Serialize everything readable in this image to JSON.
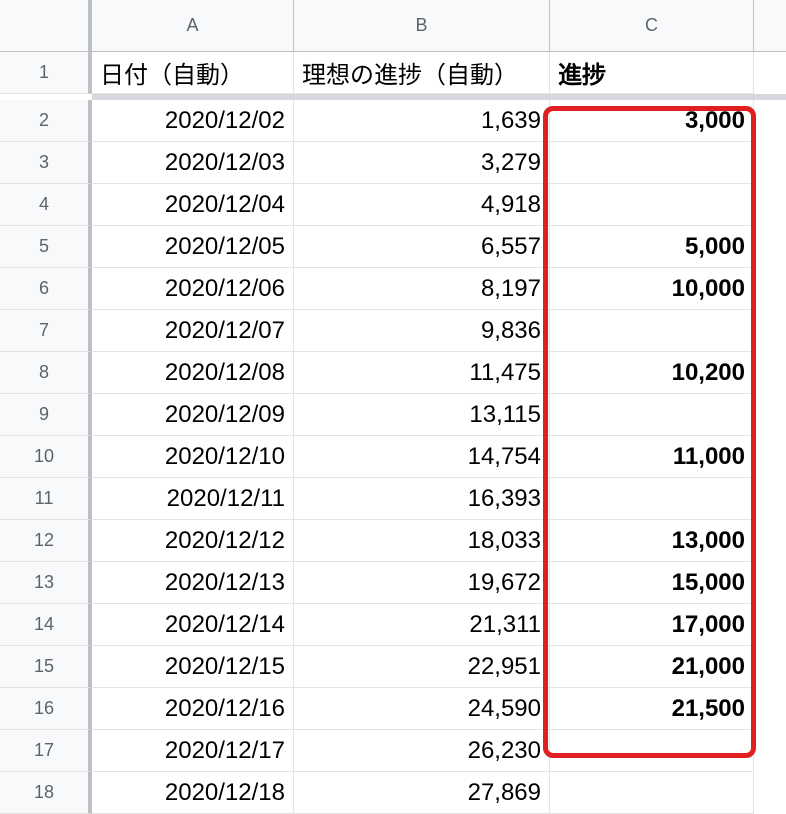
{
  "columns": [
    "A",
    "B",
    "C"
  ],
  "header_row": {
    "num": "1",
    "a": "日付（自動）",
    "b": "理想の進捗（自動）",
    "c": "進捗"
  },
  "rows": [
    {
      "num": "2",
      "date": "2020/12/02",
      "ideal": "1,639",
      "progress": "3,000"
    },
    {
      "num": "3",
      "date": "2020/12/03",
      "ideal": "3,279",
      "progress": ""
    },
    {
      "num": "4",
      "date": "2020/12/04",
      "ideal": "4,918",
      "progress": ""
    },
    {
      "num": "5",
      "date": "2020/12/05",
      "ideal": "6,557",
      "progress": "5,000"
    },
    {
      "num": "6",
      "date": "2020/12/06",
      "ideal": "8,197",
      "progress": "10,000"
    },
    {
      "num": "7",
      "date": "2020/12/07",
      "ideal": "9,836",
      "progress": ""
    },
    {
      "num": "8",
      "date": "2020/12/08",
      "ideal": "11,475",
      "progress": "10,200"
    },
    {
      "num": "9",
      "date": "2020/12/09",
      "ideal": "13,115",
      "progress": ""
    },
    {
      "num": "10",
      "date": "2020/12/10",
      "ideal": "14,754",
      "progress": "11,000"
    },
    {
      "num": "11",
      "date": "2020/12/11",
      "ideal": "16,393",
      "progress": ""
    },
    {
      "num": "12",
      "date": "2020/12/12",
      "ideal": "18,033",
      "progress": "13,000"
    },
    {
      "num": "13",
      "date": "2020/12/13",
      "ideal": "19,672",
      "progress": "15,000"
    },
    {
      "num": "14",
      "date": "2020/12/14",
      "ideal": "21,311",
      "progress": "17,000"
    },
    {
      "num": "15",
      "date": "2020/12/15",
      "ideal": "22,951",
      "progress": "21,000"
    },
    {
      "num": "16",
      "date": "2020/12/16",
      "ideal": "24,590",
      "progress": "21,500"
    },
    {
      "num": "17",
      "date": "2020/12/17",
      "ideal": "26,230",
      "progress": ""
    },
    {
      "num": "18",
      "date": "2020/12/18",
      "ideal": "27,869",
      "progress": ""
    }
  ],
  "colors": {
    "highlight_border": "#e02020",
    "header_bg": "#f8f9fa"
  }
}
